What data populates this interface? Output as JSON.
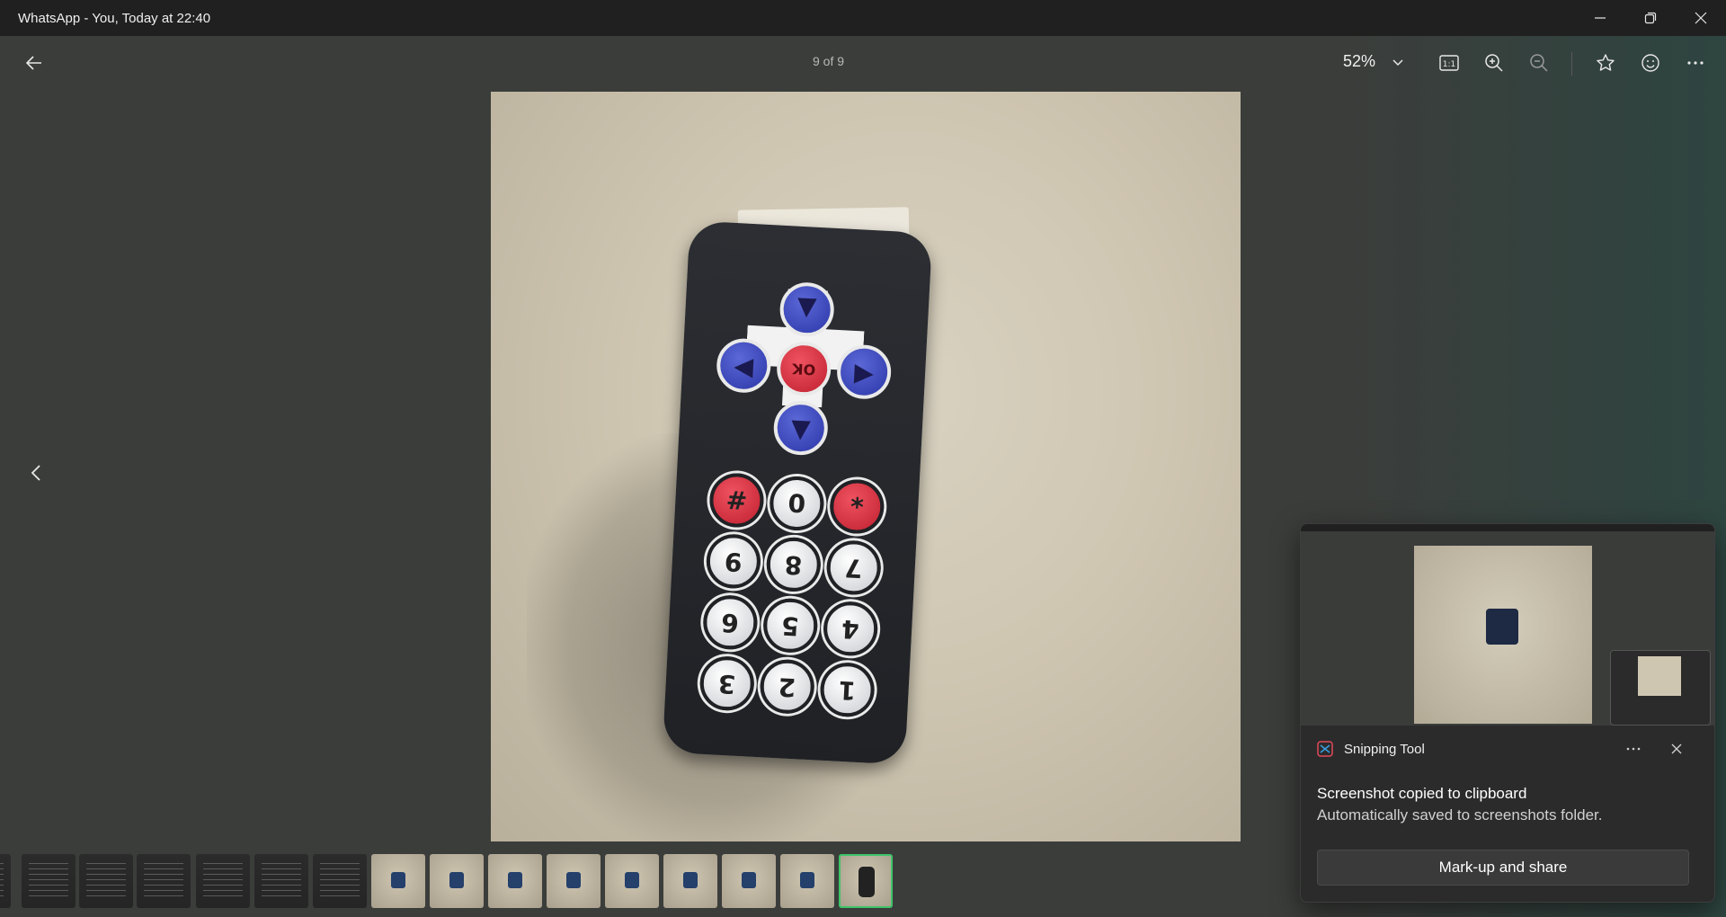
{
  "window": {
    "title": "WhatsApp - You, Today at 22:40",
    "controls": [
      "minimize-icon",
      "restore-icon",
      "close-icon"
    ]
  },
  "toolbar": {
    "back_icon": "arrow-left-icon",
    "counter": "9 of 9",
    "zoom": "52%",
    "icons": [
      "actual-size-icon",
      "zoom-in-icon",
      "zoom-out-icon",
      "star-icon",
      "emoji-icon",
      "more-icon"
    ],
    "actual_size_label": "1:1"
  },
  "photo": {
    "subject": "ir-remote",
    "keys": [
      "#",
      "0",
      "*",
      "9",
      "8",
      "7",
      "6",
      "5",
      "4",
      "3",
      "2",
      "1"
    ],
    "ok_label": "OK"
  },
  "filmstrip": {
    "count": 15,
    "active_index": 14
  },
  "notification": {
    "app_name": "Snipping Tool",
    "message_title": "Screenshot copied to clipboard",
    "message_body": "Automatically saved to screenshots folder.",
    "action_label": "Mark-up and share"
  },
  "colors": {
    "accent_active_thumb": "#3fc46a",
    "remote_blue": "#2b36a8",
    "remote_red": "#c0202f"
  }
}
